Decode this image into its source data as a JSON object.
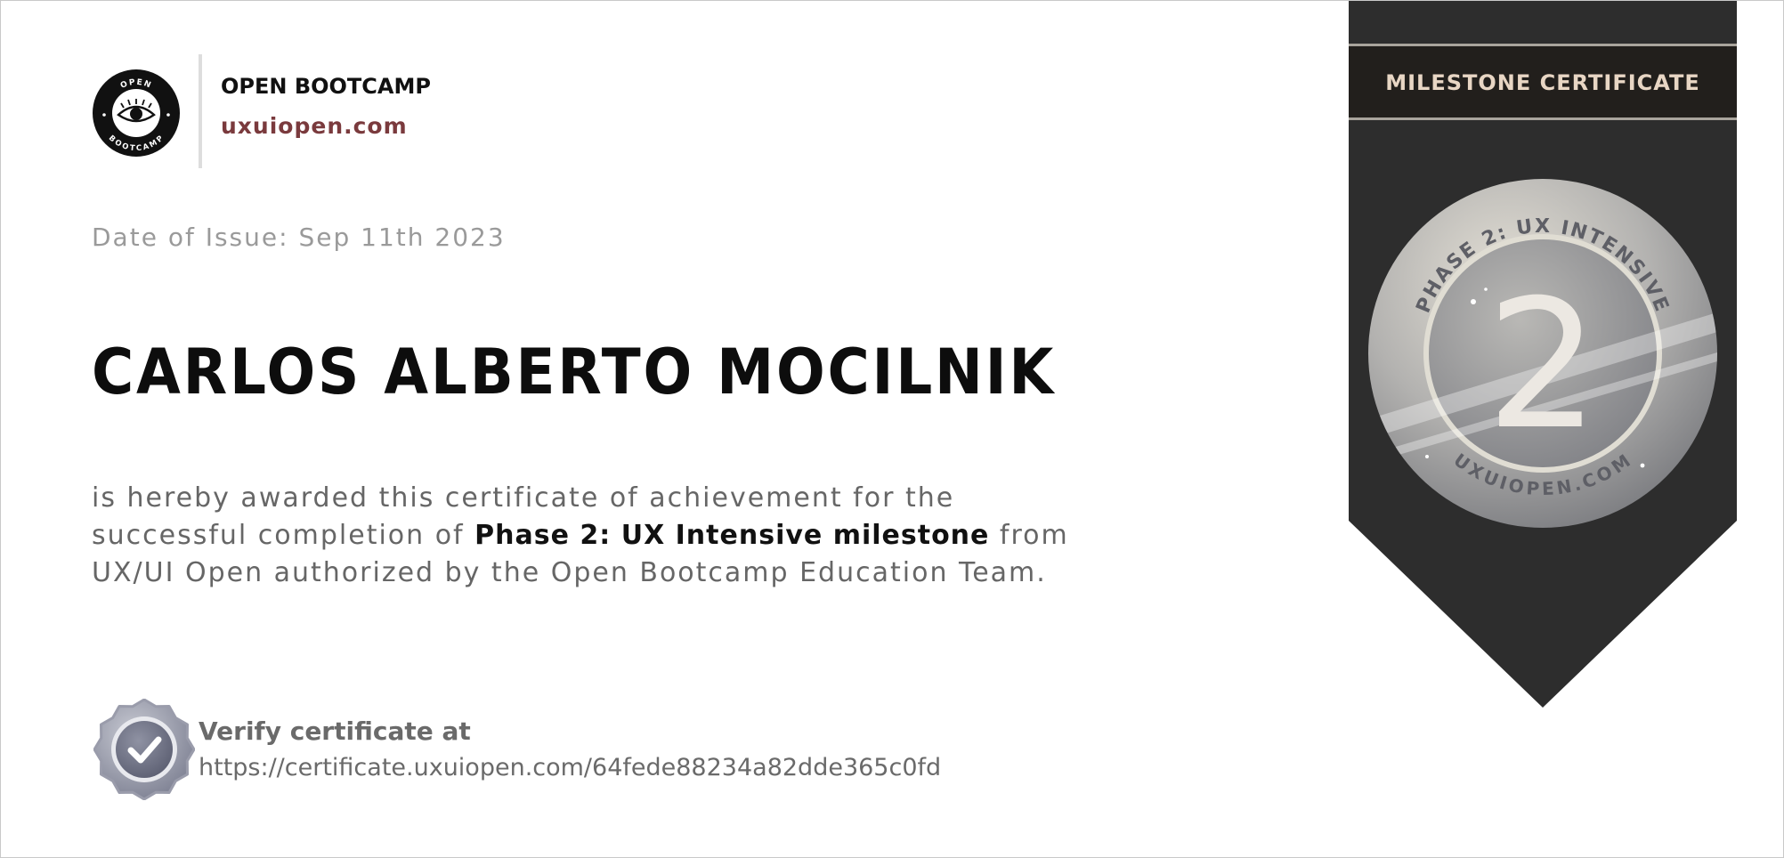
{
  "brand": {
    "logo_text_top": "OPEN",
    "logo_text_bottom": "BOOTCAMP",
    "name": "OPEN BOOTCAMP",
    "url": "uxuiopen.com"
  },
  "issue": {
    "date_line": "Date of Issue: Sep 11th 2023"
  },
  "recipient": {
    "name": "CARLOS ALBERTO MOCILNIK"
  },
  "statement": {
    "intro": "is hereby awarded this certificate of achievement for the successful completion of ",
    "highlight": "Phase 2: UX Intensive milestone",
    "outro": " from UX/UI Open authorized by the Open Bootcamp Education Team."
  },
  "verify": {
    "title": "Verify certificate at",
    "url": "https://certificate.uxuiopen.com/64fede88234a82dde365c0fd"
  },
  "ribbon": {
    "label": "MILESTONE CERTIFICATE",
    "medal_top_text": "PHASE 2: UX INTENSIVE",
    "medal_bottom_text": "UXUIOPEN.COM",
    "medal_number": "2"
  },
  "colors": {
    "ribbon": "#2d2d2d",
    "ribbon_band": "#221f1c",
    "ribbon_label": "#e8d6c4",
    "url_accent": "#7a3a3d"
  }
}
